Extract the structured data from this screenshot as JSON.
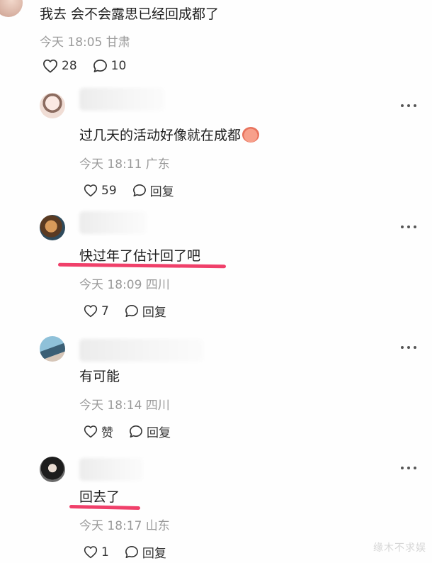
{
  "top_comment": {
    "text": "我去 会不会露思已经回成都了",
    "meta": "今天 18:05 甘肃",
    "likes": "28",
    "replies": "10"
  },
  "replies": [
    {
      "text": "过几天的活动好像就在成都",
      "meta": "今天 18:11 广东",
      "likes": "59",
      "reply_label": "回复"
    },
    {
      "text": "快过年了估计回了吧",
      "meta": "今天 18:09 四川",
      "likes": "7",
      "reply_label": "回复"
    },
    {
      "text": "有可能",
      "meta": "今天 18:14 四川",
      "likes": "赞",
      "reply_label": "回复"
    },
    {
      "text": "回去了",
      "meta": "今天 18:17 山东",
      "likes": "1",
      "reply_label": "回复"
    }
  ],
  "colors": {
    "underline": "#f0406a",
    "meta": "#9a9a9a"
  },
  "watermark": "缘木不求娱"
}
